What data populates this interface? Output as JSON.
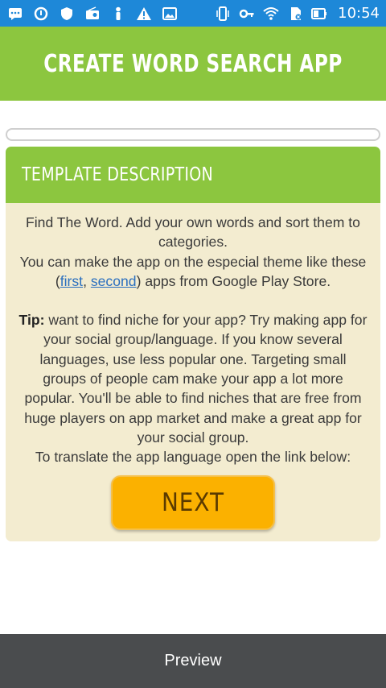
{
  "status_bar": {
    "time": "10:54",
    "left_icons": [
      "message-icon",
      "sync-icon",
      "shield-icon",
      "radio-icon",
      "figure-icon",
      "warning-icon",
      "image-icon"
    ],
    "right_icons": [
      "vibrate-icon",
      "key-icon",
      "wifi-icon",
      "sim-icon",
      "battery-icon"
    ]
  },
  "header": {
    "title": "CREATE WORD SEARCH APP"
  },
  "card": {
    "title": "TEMPLATE DESCRIPTION",
    "intro_1": "Find The Word. Add your own words and sort them to categories.",
    "intro_2_before": "You can make the app on the especial theme like these (",
    "link_first": "first",
    "comma": ", ",
    "link_second": "second",
    "intro_2_after": ") apps from Google Play Store.",
    "tip_label": "Tip:",
    "tip_text": " want to find niche for your app? Try making app for your social group/language. If you know several languages, use less popular one. Targeting small groups of people cam make your app a lot more popular. You'll be able to find niches that are free from huge players on app market and make a great app for your social group.",
    "translate_text": "To translate the app language open the link below:",
    "next_label": "NEXT"
  },
  "footer": {
    "preview_label": "Preview"
  },
  "colors": {
    "status_bar": "#1e88d8",
    "accent_green": "#8cc63f",
    "card_bg": "#f3ecd0",
    "button_orange": "#fbb100",
    "footer_bg": "#4a4c4e",
    "link": "#2a6fbf"
  }
}
